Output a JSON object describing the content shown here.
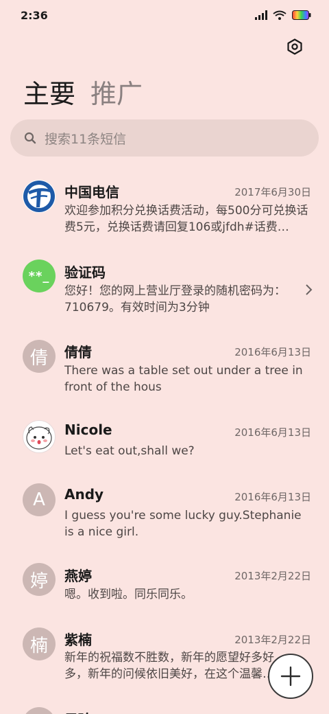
{
  "status_bar": {
    "time": "2:36"
  },
  "tabs": [
    {
      "label": "主要",
      "active": true
    },
    {
      "label": "推广",
      "active": false
    }
  ],
  "search": {
    "placeholder": "搜索11条短信"
  },
  "conversations": [
    {
      "name": "中国电信",
      "date": "2017年6月30日",
      "preview": "欢迎参加积分兑换话费活动，每500分可兑换话费5元，兑换话费请回复106或jfdh#话费…",
      "avatar_type": "telecom-logo",
      "avatar_text": ""
    },
    {
      "name": "验证码",
      "date": "",
      "preview": "您好！您的网上营业厅登录的随机密码为：710679。有效时间为3分钟",
      "avatar_type": "code",
      "avatar_text": "**_"
    },
    {
      "name": "倩倩",
      "date": "2016年6月13日",
      "preview": "There was a table set out under a tree in front of the hous",
      "avatar_type": "letter",
      "avatar_text": "倩"
    },
    {
      "name": "Nicole",
      "date": "2016年6月13日",
      "preview": "Let's eat out,shall we?",
      "avatar_type": "photo",
      "avatar_text": ""
    },
    {
      "name": "Andy",
      "date": "2016年6月13日",
      "preview": "I guess you're some lucky guy.Stephanie is a nice girl.",
      "avatar_type": "letter",
      "avatar_text": "A"
    },
    {
      "name": "燕婷",
      "date": "2013年2月22日",
      "preview": "嗯。收到啦。同乐同乐。",
      "avatar_type": "letter",
      "avatar_text": "婷"
    },
    {
      "name": "紫楠",
      "date": "2013年2月22日",
      "preview": "新年的祝福数不胜数，新年的愿望好多好多，新年的问候依旧美好，在这个温馨的时刻",
      "avatar_type": "letter",
      "avatar_text": "楠"
    },
    {
      "name": "子玲",
      "date": "",
      "preview": "",
      "avatar_type": "letter",
      "avatar_text": ""
    }
  ],
  "colors": {
    "background": "#fbe4e1",
    "search_bg": "#ead4d0",
    "avatar_letter": "#ccb7b4",
    "avatar_code": "#6ad25d",
    "telecom_blue": "#1e5aa8"
  },
  "icons": {
    "settings": "settings-icon",
    "search": "search-icon",
    "compose": "plus-icon",
    "chevron": "chevron-right-icon"
  }
}
